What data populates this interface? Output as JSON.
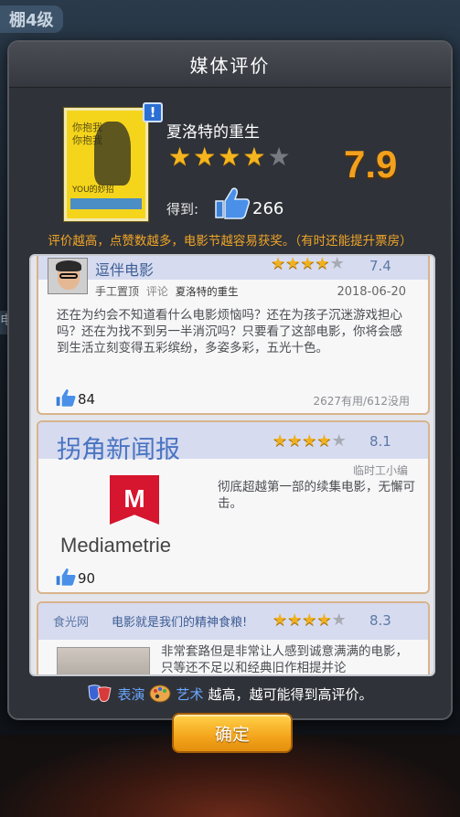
{
  "background": {
    "top_label": "棚4级",
    "side_label": "电"
  },
  "modal": {
    "title": "媒体评价"
  },
  "movie": {
    "title": "夏洛特的重生",
    "stars": 4,
    "star_max": 5,
    "score": "7.9",
    "gain_label": "得到:",
    "likes": "266",
    "info_badge": "!",
    "poster_lines": [
      "你抱我",
      "你抱我"
    ],
    "poster_bottom": "YOU的妙招"
  },
  "hint": "评价越高，点赞数越多，电影节越容易获奖。（有时还能提升票房）",
  "reviews": [
    {
      "name": "逗伴电影",
      "stars": 4,
      "score": "7.4",
      "tag": "手工置顶",
      "type": "评论",
      "movie": "夏洛特的重生",
      "date": "2018-06-20",
      "text": "还在为约会不知道看什么电影烦恼吗？还在为孩子沉迷游戏担心吗？还在为找不到另一半消沉吗？只要看了这部电影，你将会感到生活立刻变得五彩缤纷，多姿多彩，五光十色。",
      "likes": "84",
      "useful": "2627有用/612没用"
    },
    {
      "name": "拐角新闻报",
      "stars": 4,
      "score": "8.1",
      "role": "临时工小编",
      "logo_text": "Mediametrie",
      "logo_letter": "M",
      "text": "彻底超越第一部的续集电影，无懈可击。",
      "likes": "90"
    },
    {
      "name": "食光网",
      "slogan": "电影就是我们的精神食粮!",
      "stars": 4,
      "score": "8.3",
      "text": "非常套路但是非常让人感到诚意满满的电影，只等还不足以和经典旧作相提并论"
    }
  ],
  "footer": {
    "skill1": "表演",
    "skill2": "艺术",
    "text": "越高，越可能得到高评价。",
    "confirm": "确定"
  },
  "colors": {
    "accent": "#f3a01b",
    "star": "#f5b51e",
    "link": "#3f5f95"
  }
}
